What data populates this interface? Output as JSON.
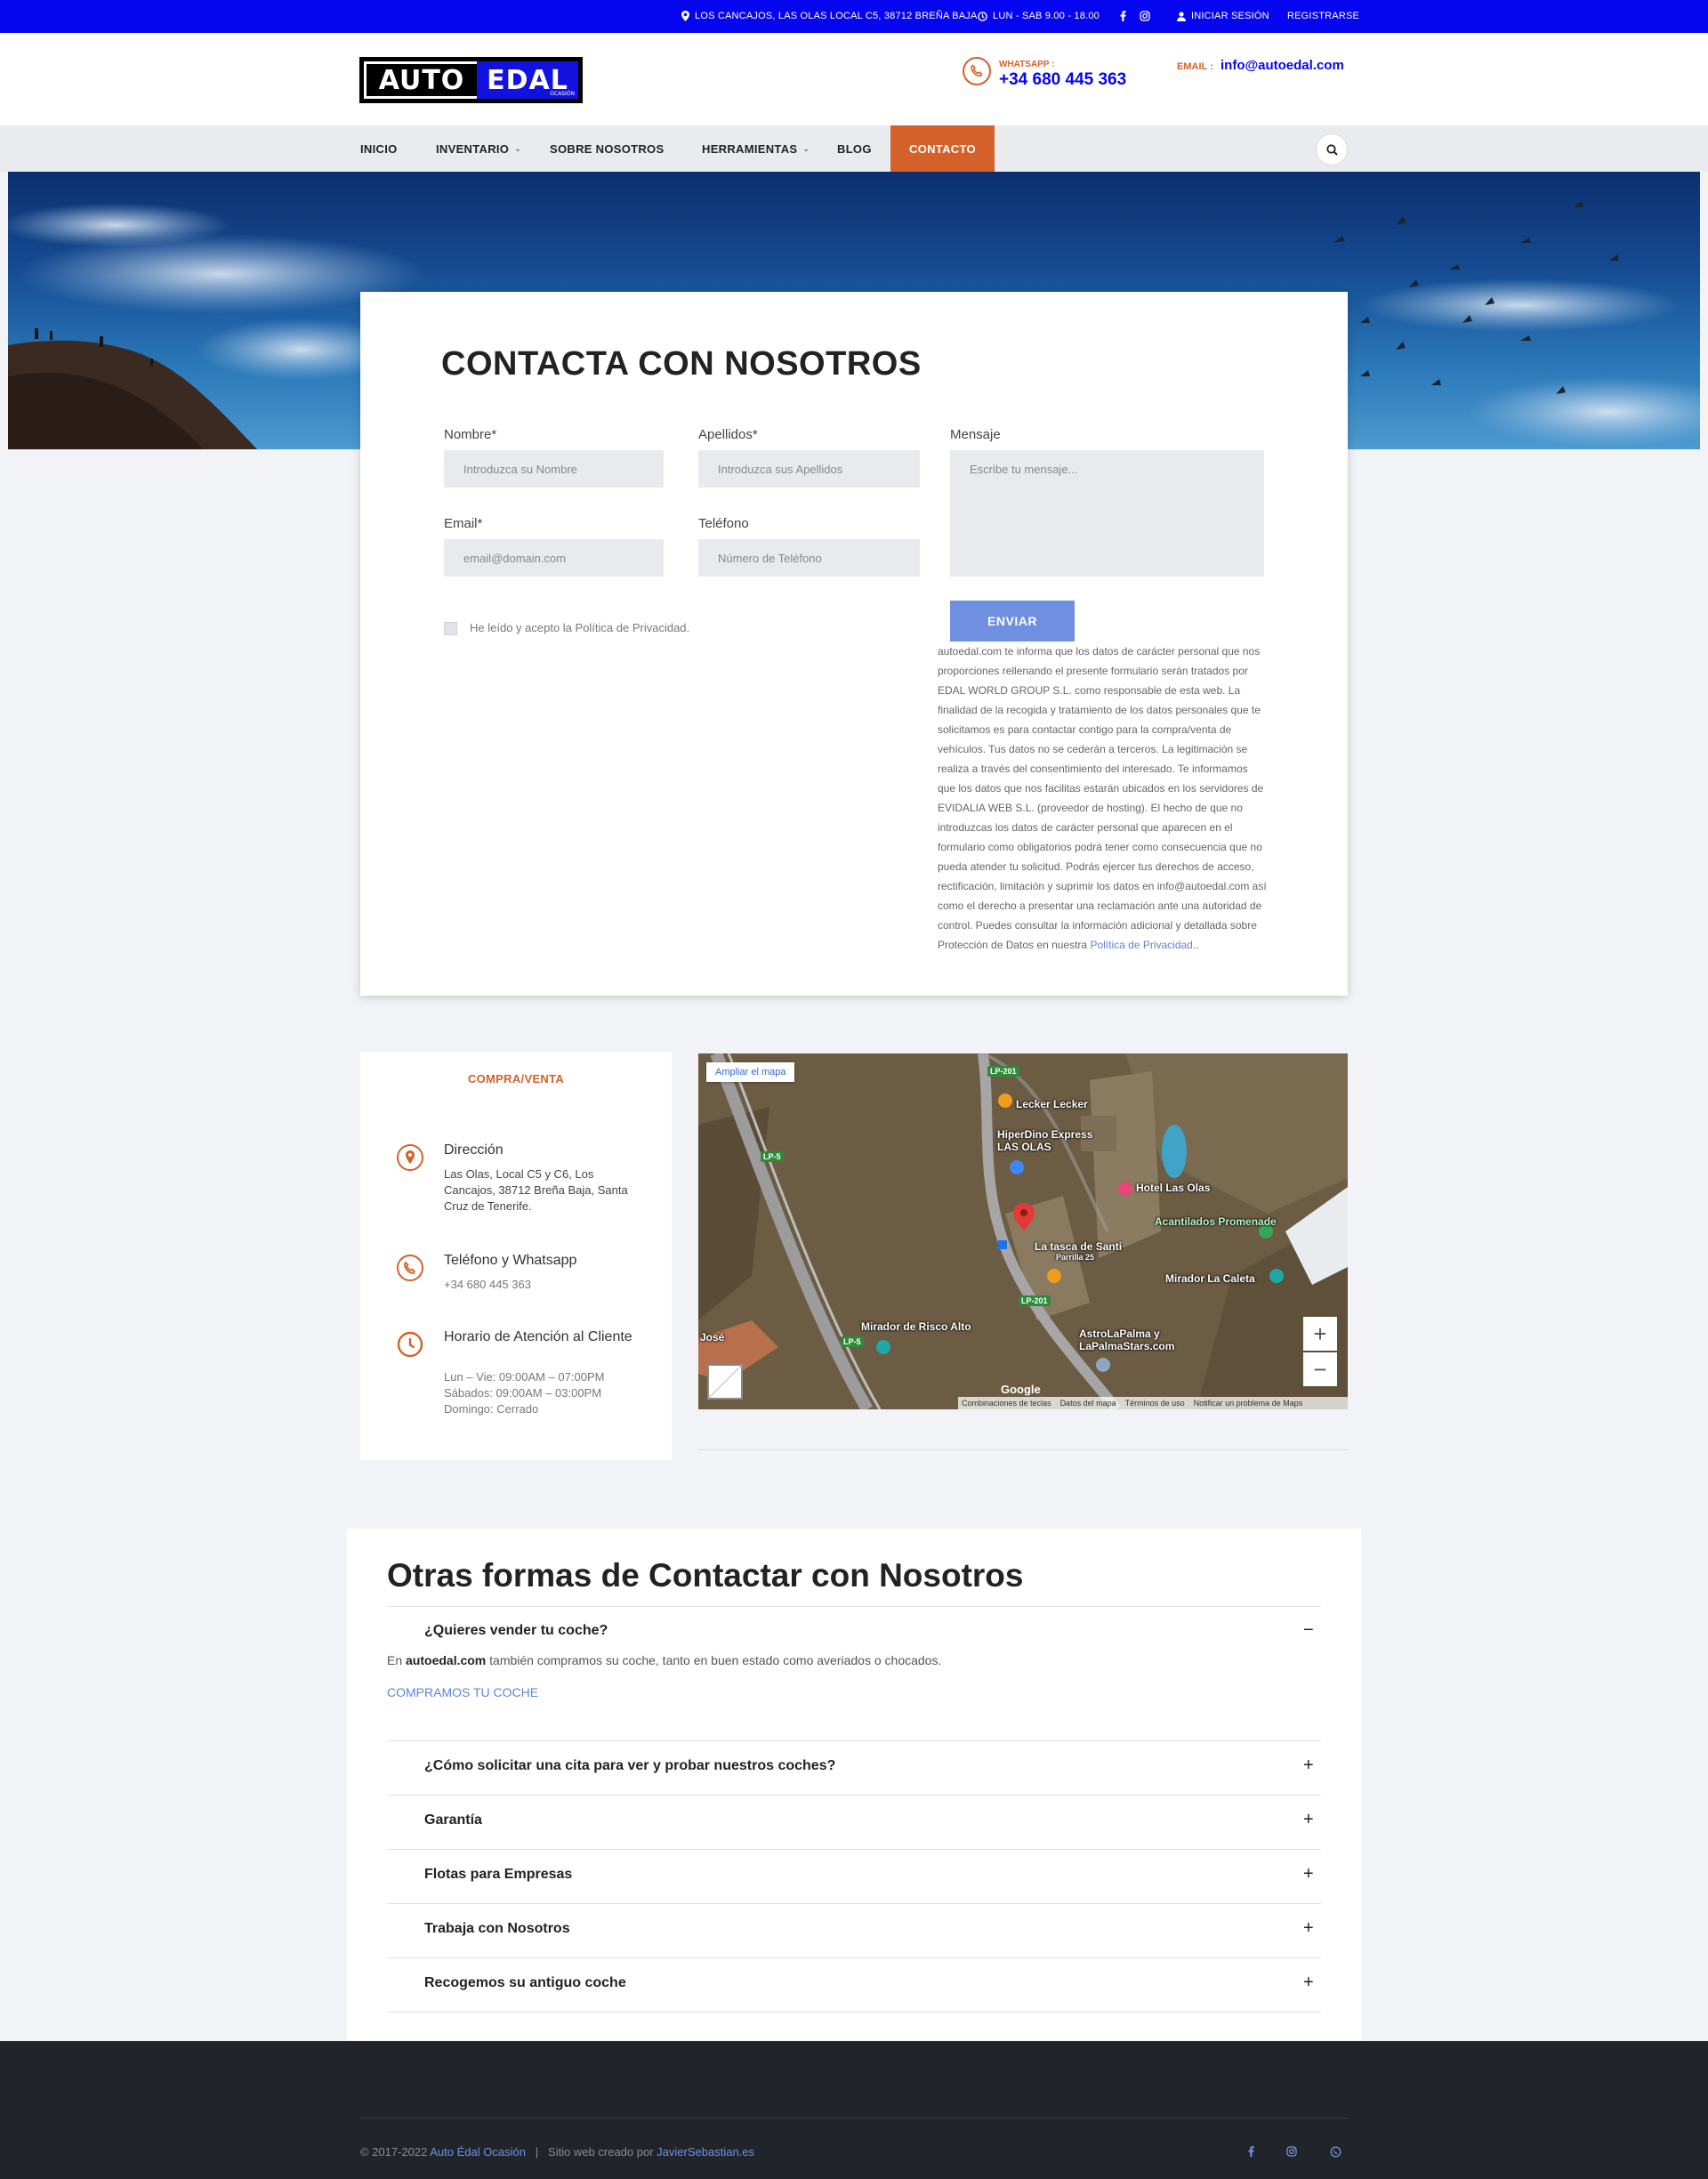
{
  "topbar": {
    "address": "LOS CANCAJOS, LAS OLAS LOCAL C5, 38712 BREÑA BAJA",
    "hours": "LUN - SAB 9.00 - 18.00",
    "login": "INICIAR SESIÓN",
    "register": "REGISTRARSE"
  },
  "header": {
    "logo_left": "AUTO",
    "logo_right": "EDAL",
    "logo_small": "OCASIÓN",
    "whatsapp_label": "WHATSAPP :",
    "whatsapp_phone": "+34 680 445 363",
    "email_label": "EMAIL :",
    "email_value": "info@autoedal.com"
  },
  "nav": {
    "items": [
      "INICIO",
      "INVENTARIO",
      "SOBRE NOSOTROS",
      "HERRAMIENTAS",
      "BLOG",
      "CONTACTO"
    ],
    "active": "CONTACTO"
  },
  "form": {
    "title": "CONTACTA CON NOSOTROS",
    "nombre_label": "Nombre*",
    "nombre_placeholder": "Introduzca su Nombre",
    "apellidos_label": "Apellidos*",
    "apellidos_placeholder": "Introduzca sus Apellidos",
    "email_label": "Email*",
    "email_placeholder": "email@domain.com",
    "telefono_label": "Teléfono",
    "telefono_placeholder": "Número de Teléfono",
    "mensaje_label": "Mensaje",
    "mensaje_placeholder": "Escribe tu mensaje...",
    "privacy_check": "He leído y acepto la Política de Privacidad.",
    "send": "ENVIAR",
    "privacy_text": "autoedal.com te informa que los datos de carácter personal que nos proporciones rellenando el presente formulario serán tratados por EDAL WORLD GROUP S.L. como responsable de esta web. La finalidad de la recogida y tratamiento de los datos personales que te solicitamos es para contactar contigo para la compra/venta de vehículos. Tus datos no se cederán a terceros. La legitimación se realiza a través del consentimiento del interesado. Te informamos que los datos que nos facilitas estarán ubicados en los servidores de EVIDALIA WEB S.L. (proveedor de hosting). El hecho de que no introduzcas los datos de carácter personal que aparecen en el formulario como obligatorios podrá tener como consecuencia que no pueda atender tu solicitud. Podrás ejercer tus derechos de acceso, rectificación, limitación y suprimir los datos en info@autoedal.com así como el derecho a presentar una reclamación ante una autoridad de control. Puedes consultar la información adicional y detallada sobre Protección de Datos en nuestra",
    "privacy_link": "Política de Privacidad",
    "privacy_end": ".."
  },
  "info": {
    "title": "COMPRA/VENTA",
    "address_head": "Dirección",
    "address_text": "Las Olas, Local C5 y C6, Los Cancajos, 38712 Breña Baja, Santa Cruz de Tenerife.",
    "phone_head": "Teléfono y Whatsapp",
    "phone_text": "+34 680 445 363",
    "hours_head": "Horario de Atención al Cliente",
    "hours_1": "Lun – Vie: 09:00AM – 07:00PM",
    "hours_2": "Sábados: 09:00AM – 03:00PM",
    "hours_3": "Domingo: Cerrado"
  },
  "map": {
    "enlarge": "Ampliar el mapa",
    "labels": [
      "Lecker Lecker",
      "HiperDino Express LAS OLAS",
      "Hotel Las Olas",
      "Acantilados Promenade",
      "La tasca de Santi",
      "Parrilla 25",
      "Mirador La Caleta",
      "Mirador de Risco Alto",
      "AstroLaPalma y LaPalmaStars.com",
      "José"
    ],
    "roads": [
      "LP-201",
      "LP-5",
      "LP-201",
      "LP-5"
    ],
    "footer": [
      "Combinaciones de teclas",
      "Datos del mapa",
      "Términos de uso",
      "Notificar un problema de Maps"
    ],
    "google": "Google"
  },
  "faq": {
    "title": "Otras formas de Contactar con Nosotros",
    "open_question": "¿Quieres vender tu coche?",
    "open_answer_brand": "autoedal.com",
    "open_answer_pre": "En",
    "open_answer_rest": "también compramos su coche, tanto en buen estado como averiados o chocados.",
    "open_link": "COMPRAMOS TU COCHE",
    "questions": [
      "¿Cómo solicitar una cita para ver y probar nuestros coches?",
      "Garantía",
      "Flotas para Empresas",
      "Trabaja con Nosotros",
      "Recogemos su antiguo coche"
    ]
  },
  "footer": {
    "copy": "© 2017-2022",
    "brand": "Auto Édal Ocasión",
    "sep": "|",
    "credit": "Sitio web creado por",
    "credit_link": "JavierSebastian.es"
  },
  "colors": {
    "brand_blue": "#0505ef",
    "accent_orange": "#d4612a",
    "link_blue": "#5c84d8",
    "footer_bg": "#212428"
  }
}
